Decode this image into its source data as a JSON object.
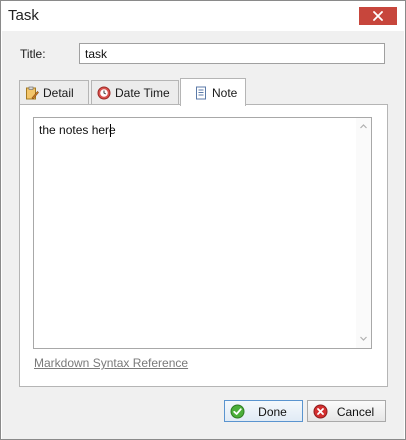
{
  "window": {
    "title": "Task"
  },
  "form": {
    "title_label": "Title:",
    "title_value": "task"
  },
  "tabs": [
    {
      "label": "Detail",
      "icon": "clipboard-pencil-icon",
      "active": false
    },
    {
      "label": "Date Time",
      "icon": "clock-icon",
      "active": false
    },
    {
      "label": "Note",
      "icon": "document-icon",
      "active": true
    }
  ],
  "note": {
    "text": "the notes here",
    "markdown_link": "Markdown Syntax Reference"
  },
  "buttons": {
    "done_label": "Done",
    "cancel_label": "Cancel"
  },
  "colors": {
    "close_button": "#c7463c",
    "done_icon": "#4caf3a",
    "cancel_icon": "#d32f2f",
    "date_tab_icon": "#d9534f",
    "link": "#7a7a7a"
  }
}
